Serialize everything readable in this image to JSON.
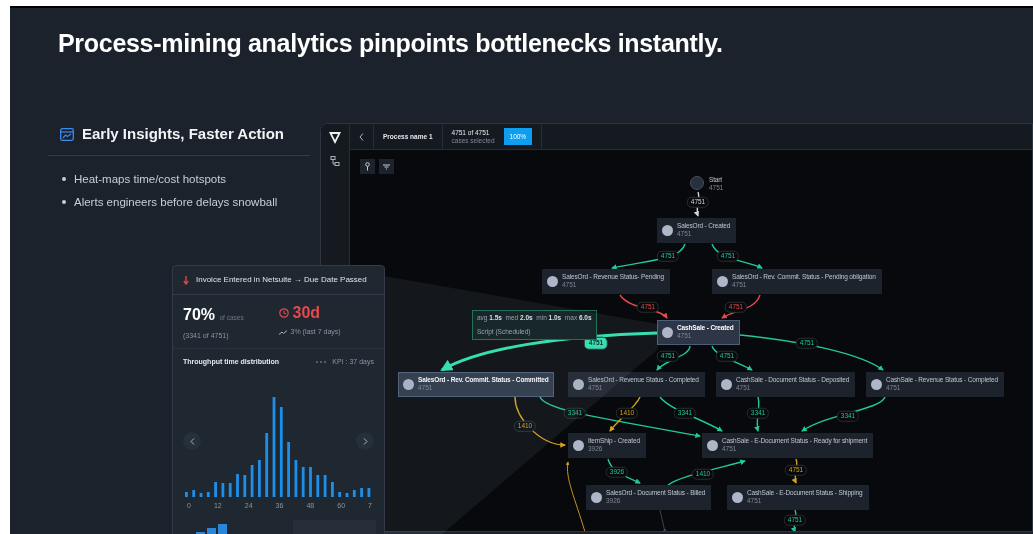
{
  "headline": "Process-mining analytics pinpoints bottlenecks instantly.",
  "feature": {
    "title": "Early Insights, Faster Action",
    "bullets": [
      "Heat-maps time/cost hotspots",
      "Alerts engineers before delays snowball"
    ]
  },
  "app": {
    "process_name": "Process name 1",
    "cases_count": "4751 of 4751",
    "cases_caption": "cases selected",
    "selection_badge": "100%",
    "nodes": [
      {
        "kind": "start",
        "title": "Start",
        "count": "4751"
      },
      {
        "kind": "step",
        "title": "SalesOrd - Created",
        "count": "4751",
        "highlighted": false
      },
      {
        "kind": "step",
        "title": "SalesOrd - Revenue Status- Pending",
        "count": "4751",
        "highlighted": false
      },
      {
        "kind": "step",
        "title": "SalesOrd - Rev. Commit. Status - Pending obligation",
        "count": "4751",
        "highlighted": false
      },
      {
        "kind": "step",
        "title": "CashSale - Created",
        "count": "4751",
        "highlighted": true
      },
      {
        "kind": "step",
        "title": "SalesOrd - Rev. Commit. Status - Committed",
        "count": "4751",
        "highlighted": true
      },
      {
        "kind": "step",
        "title": "SalesOrd - Revenue Status - Completed",
        "count": "4751",
        "highlighted": false
      },
      {
        "kind": "step",
        "title": "CashSale - Document Status - Deposited",
        "count": "4751",
        "highlighted": false
      },
      {
        "kind": "step",
        "title": "CashSale - Revenue Status - Completed",
        "count": "4751",
        "highlighted": false
      },
      {
        "kind": "step",
        "title": "ItemShip - Created",
        "count": "3926",
        "highlighted": false
      },
      {
        "kind": "step",
        "title": "CashSale - E-Document Status - Ready for shipment",
        "count": "4751",
        "highlighted": false
      },
      {
        "kind": "step",
        "title": "SalesOrd - Document Status - Billed",
        "count": "3926",
        "highlighted": false
      },
      {
        "kind": "step",
        "title": "CashSale - E-Document Status - Shipping",
        "count": "4751",
        "highlighted": false
      }
    ],
    "edges": [
      {
        "label": "4751",
        "color": "#cfd6df"
      },
      {
        "label": "4751",
        "color": "#1fc99a"
      },
      {
        "label": "4751",
        "color": "#1fc99a"
      },
      {
        "label": "4751",
        "color": "#e5484d"
      },
      {
        "label": "4751",
        "color": "#e5484d"
      },
      {
        "label": "4751",
        "color": "#2ee6b0"
      },
      {
        "label": "4751",
        "color": "#1fc99a"
      },
      {
        "label": "4751",
        "color": "#1fc99a"
      },
      {
        "label": "4751",
        "color": "#1fc99a"
      },
      {
        "label": "3341",
        "color": "#1fc99a"
      },
      {
        "label": "3341",
        "color": "#1fc99a"
      },
      {
        "label": "3341",
        "color": "#1fc99a"
      },
      {
        "label": "3341",
        "color": "#1fc99a"
      },
      {
        "label": "1410",
        "color": "#d9a21b"
      },
      {
        "label": "1410",
        "color": "#d9a21b"
      },
      {
        "label": "3926",
        "color": "#1fc99a"
      },
      {
        "label": "1410",
        "color": "#1fc99a"
      },
      {
        "label": "4751",
        "color": "#d9a21b"
      },
      {
        "label": "4751",
        "color": "#1fc99a"
      }
    ],
    "tooltip": {
      "stats": [
        {
          "label": "avg",
          "value": "1.5s"
        },
        {
          "label": "med",
          "value": "2.0s"
        },
        {
          "label": "min",
          "value": "1.0s"
        },
        {
          "label": "max",
          "value": "6.0s"
        }
      ],
      "caption": "Script (Scheduled)"
    }
  },
  "insight_card": {
    "title": "Invoice Entered in Netsuite → Due Date Passed",
    "share": "70%",
    "share_caption": "of cases",
    "share_detail": "(3341 of 4751)",
    "duration": "30d",
    "trend": "3% (last 7 days)",
    "chart_title": "Throughput time distribution",
    "kpi": "KPI : 37 days",
    "x_tick_labels": [
      "0",
      "12",
      "24",
      "36",
      "48",
      "60",
      "7"
    ]
  }
}
